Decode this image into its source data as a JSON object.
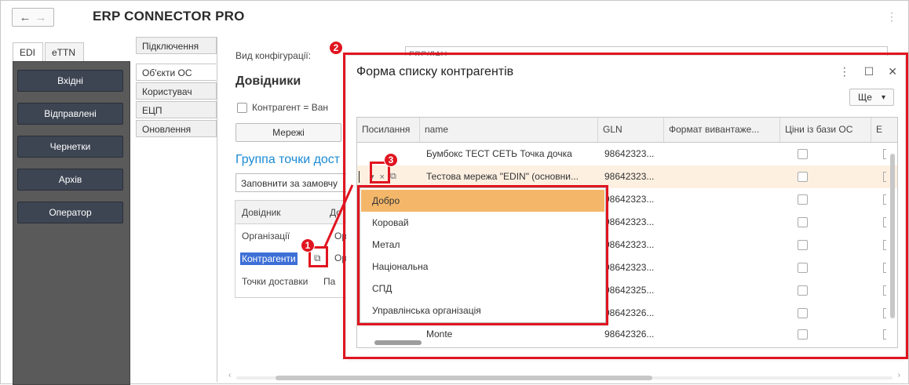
{
  "app": {
    "title": "ERP CONNECTOR PRO",
    "back_glyph": "←",
    "forward_glyph": "→",
    "menu_glyph": "⋮"
  },
  "left_tabs": [
    "EDI",
    "eTTN"
  ],
  "left_nav": [
    "Вхідні",
    "Відправлені",
    "Чернетки",
    "Архів",
    "Оператор"
  ],
  "settings_tabs": [
    "Підключення",
    "Об'єкти ОС",
    "Користувач",
    "ЕЦП",
    "Оновлення"
  ],
  "form": {
    "config_label": "Вид конфігурації:",
    "config_value": "ERP/ДАЦ",
    "directories_heading": "Довідники",
    "contractor_check_label": "Контрагент = Ван",
    "networks_button": "Мережі",
    "group_heading": "Группа точки дост",
    "fill_default_button": "Заповнити за замовчу",
    "dir_table": {
      "header": [
        "Довідник",
        "До"
      ],
      "rows": [
        {
          "name": "Організації",
          "value": "Ор"
        },
        {
          "name": "Контрагенти",
          "value": "Ор",
          "selected": true
        },
        {
          "name": "Точки доставки",
          "value": "Па"
        }
      ]
    }
  },
  "annotations": {
    "badge1": "1",
    "badge2": "2",
    "badge3": "3",
    "color": "#e01520"
  },
  "dialog": {
    "title": "Форма списку контрагентів",
    "kebab_glyph": "⋮",
    "maximize_glyph": "☐",
    "close_glyph": "✕",
    "more_button": "Ще",
    "more_glyph": "▾",
    "columns": [
      "Посилання",
      "name",
      "GLN",
      "Формат вивантаже...",
      "Ціни із бази ОС",
      "Е"
    ],
    "rows": [
      {
        "name": "Бумбокс ТЕСТ СЕТЬ Точка дочка",
        "gln": "98642323..."
      },
      {
        "name": "Тестова мережа \"EDIN\" (основни...",
        "gln": "98642323...",
        "highlighted": true
      },
      {
        "name": "",
        "gln": "98642323..."
      },
      {
        "name": "",
        "gln": "98642323..."
      },
      {
        "name": "",
        "gln": "98642323..."
      },
      {
        "name": "",
        "gln": "98642323..."
      },
      {
        "name": "",
        "gln": "98642325..."
      },
      {
        "name": "",
        "gln": "98642326..."
      },
      {
        "name": "Monte",
        "gln": "98642326..."
      }
    ],
    "edit_controls": {
      "dropdown_glyph": "▾",
      "clear_glyph": "×",
      "open_glyph": "⧉"
    }
  },
  "dropdown": {
    "items": [
      "Добро",
      "Коровай",
      "Метал",
      "Національна",
      "СПД",
      "Управлінська організація"
    ],
    "selected_index": 0,
    "highlight_color": "#f4b76a"
  }
}
